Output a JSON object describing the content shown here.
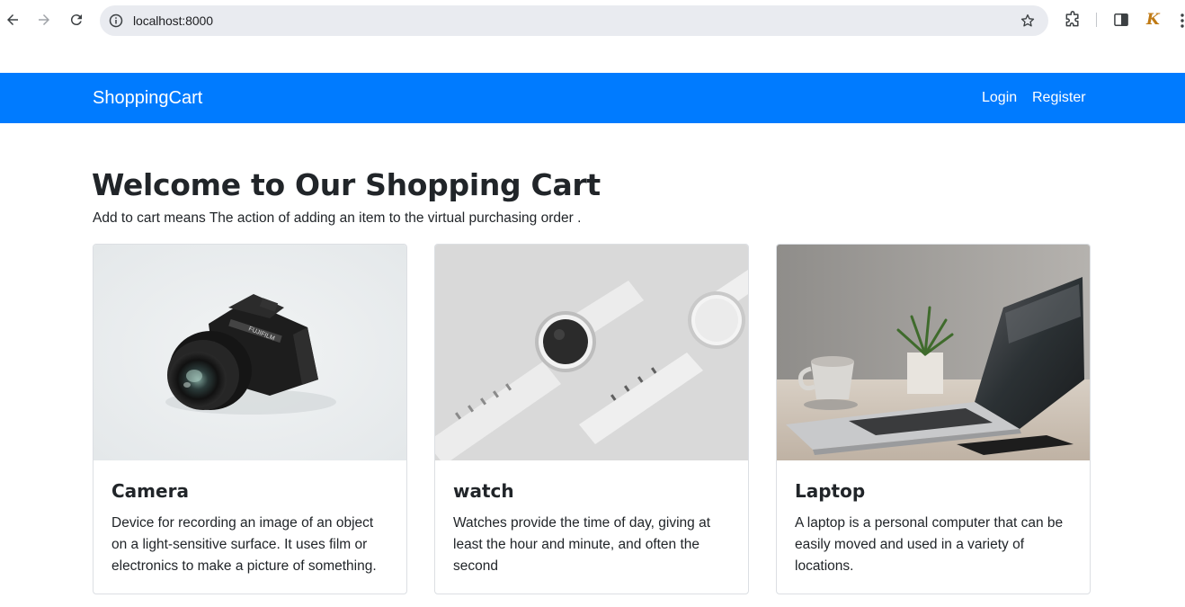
{
  "browser": {
    "url": "localhost:8000",
    "profile_initial": "K"
  },
  "navbar": {
    "brand": "ShoppingCart",
    "login_label": "Login",
    "register_label": "Register",
    "background_color": "#007bff"
  },
  "main": {
    "heading": "Welcome to Our Shopping Cart",
    "lead": "Add to cart means The action of adding an item to the virtual purchasing order .",
    "cards": [
      {
        "title": "Camera",
        "text": "Device for recording an image of an object on a light-sensitive surface. It uses film or electronics to make a picture of something.",
        "image": "camera-photo"
      },
      {
        "title": "watch",
        "text": "Watches provide the time of day, giving at least the hour and minute, and often the second",
        "image": "watch-photo"
      },
      {
        "title": "Laptop",
        "text": "A laptop is a personal computer that can be easily moved and used in a variety of locations.",
        "image": "laptop-photo"
      }
    ]
  }
}
